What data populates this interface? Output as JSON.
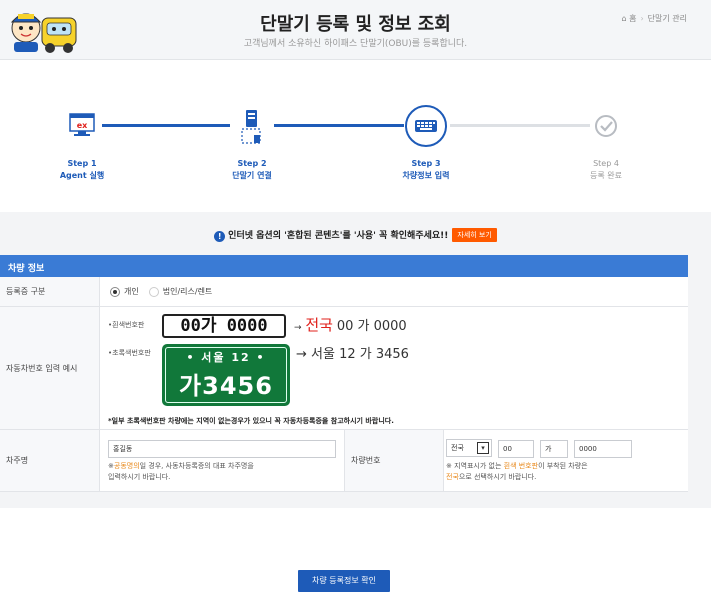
{
  "header": {
    "title": "단말기 등록 및 정보 조회",
    "subtitle": "고객님께서 소유하신 하이패스 단말기(OBU)를 등록합니다.",
    "breadcrumb": [
      "홈",
      "단말기 관리"
    ]
  },
  "steps": [
    {
      "label_line1": "Step 1",
      "label_line2": "Agent 실행",
      "state": "done",
      "icon": "ex-monitor-icon"
    },
    {
      "label_line1": "Step 2",
      "label_line2": "단말기 연결",
      "state": "done",
      "icon": "device-connect-icon"
    },
    {
      "label_line1": "Step 3",
      "label_line2": "차량정보 입력",
      "state": "current",
      "icon": "keyboard-icon"
    },
    {
      "label_line1": "Step 4",
      "label_line2": "등록 완료",
      "state": "pending",
      "icon": "check-circle-icon"
    }
  ],
  "notice": {
    "text": "인터넷 옵션의 '혼합된 콘텐츠'를 '사용' 꼭 확인해주세요!!",
    "more_label": "자세히 보기"
  },
  "section_title": "차량 정보",
  "form": {
    "reg_type": {
      "label": "등록증 구분",
      "options": [
        "개인",
        "법인/리스/렌트"
      ],
      "selected": "개인"
    },
    "example": {
      "label": "자동차번호 입력 예시",
      "white_plate_caption": "•흰색번호판",
      "white_plate_text": "00가 0000",
      "white_arrow": "→",
      "white_region": "전국",
      "white_rest": "00 가 0000",
      "green_plate_caption": "•초록색번호판",
      "green_plate_line1": "•  서울 12  •",
      "green_plate_line2": "가3456",
      "green_result": "→ 서울 12 가 3456",
      "note": "*일부 초록색번호판 차량에는 지역이 없는경우가 있으니 꼭 자동차등록증을 참고하시기 바랍니다."
    },
    "owner": {
      "label": "차주명",
      "value": "홍길동",
      "hint_prefix": "※",
      "hint_highlight": "공동명의",
      "hint_rest": "일 경우, 사동차등록증의 대표 차주명을",
      "hint_line2": "입력하시기 바랍니다."
    },
    "plate": {
      "label": "차량번호",
      "region_value": "전국",
      "num1": "00",
      "hangul": "가",
      "num2": "0000",
      "hint_prefix": "※ 지역표시가 없는",
      "hint_highlight": "흰색 번호판",
      "hint_rest": "이 부착된 차량은",
      "hint_line2_highlight": "전국",
      "hint_line2_rest": "으로 선택하시기 바랍니다."
    }
  },
  "confirm_label": "차량 등록정보 확인",
  "colors": {
    "primary": "#1e5bb8",
    "section": "#3a7bd5",
    "accent": "#ff5a00",
    "plate_green": "#11783a"
  }
}
